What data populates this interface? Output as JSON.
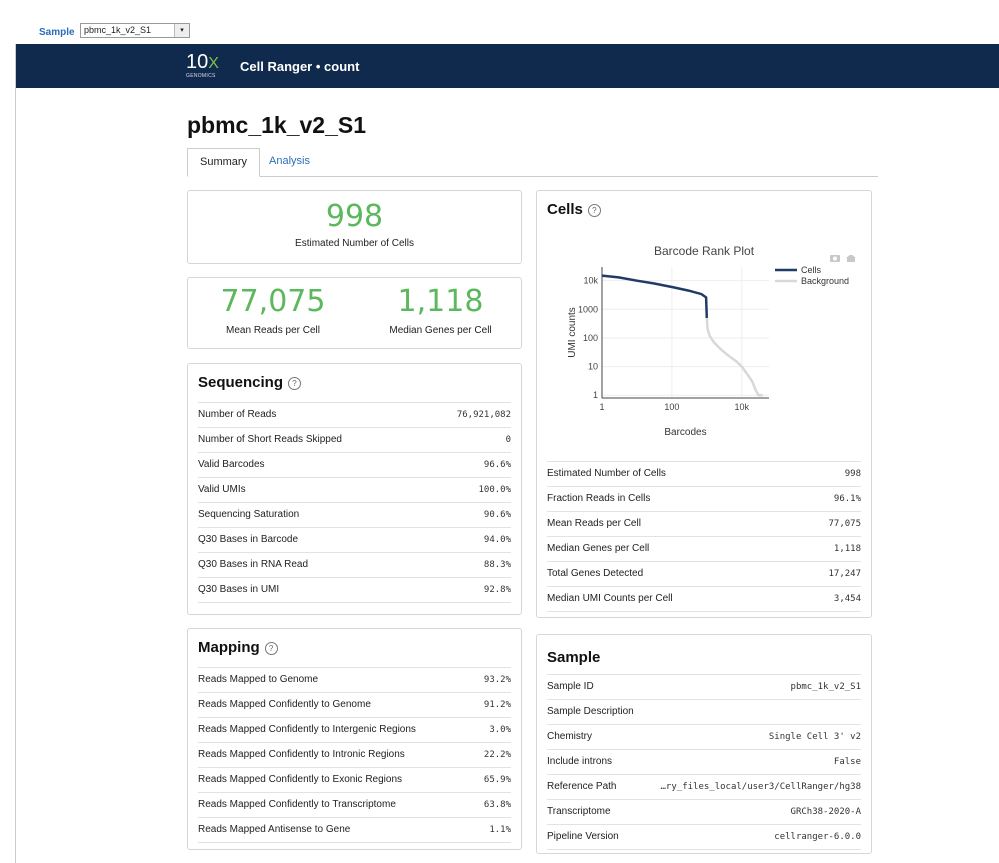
{
  "sample_selector": {
    "label": "Sample",
    "value": "pbmc_1k_v2_S1",
    "arrow": "▾"
  },
  "navbar": {
    "logo_main": "10",
    "logo_x": "X",
    "logo_sub": "GENOMICS",
    "title": "Cell Ranger • count"
  },
  "page": {
    "title": "pbmc_1k_v2_S1"
  },
  "tabs": [
    {
      "label": "Summary"
    },
    {
      "label": "Analysis"
    }
  ],
  "hero": {
    "cells": {
      "value": "998",
      "label": "Estimated Number of Cells"
    },
    "mean_reads": {
      "value": "77,075",
      "label": "Mean Reads per Cell"
    },
    "median_genes": {
      "value": "1,118",
      "label": "Median Genes per Cell"
    }
  },
  "sequencing": {
    "title": "Sequencing",
    "rows": [
      {
        "k": "Number of Reads",
        "v": "76,921,082"
      },
      {
        "k": "Number of Short Reads Skipped",
        "v": "0"
      },
      {
        "k": "Valid Barcodes",
        "v": "96.6%"
      },
      {
        "k": "Valid UMIs",
        "v": "100.0%"
      },
      {
        "k": "Sequencing Saturation",
        "v": "90.6%"
      },
      {
        "k": "Q30 Bases in Barcode",
        "v": "94.0%"
      },
      {
        "k": "Q30 Bases in RNA Read",
        "v": "88.3%"
      },
      {
        "k": "Q30 Bases in UMI",
        "v": "92.8%"
      }
    ]
  },
  "mapping": {
    "title": "Mapping",
    "rows": [
      {
        "k": "Reads Mapped to Genome",
        "v": "93.2%"
      },
      {
        "k": "Reads Mapped Confidently to Genome",
        "v": "91.2%"
      },
      {
        "k": "Reads Mapped Confidently to Intergenic Regions",
        "v": "3.0%"
      },
      {
        "k": "Reads Mapped Confidently to Intronic Regions",
        "v": "22.2%"
      },
      {
        "k": "Reads Mapped Confidently to Exonic Regions",
        "v": "65.9%"
      },
      {
        "k": "Reads Mapped Confidently to Transcriptome",
        "v": "63.8%"
      },
      {
        "k": "Reads Mapped Antisense to Gene",
        "v": "1.1%"
      }
    ]
  },
  "cells": {
    "title": "Cells",
    "rows": [
      {
        "k": "Estimated Number of Cells",
        "v": "998"
      },
      {
        "k": "Fraction Reads in Cells",
        "v": "96.1%"
      },
      {
        "k": "Mean Reads per Cell",
        "v": "77,075"
      },
      {
        "k": "Median Genes per Cell",
        "v": "1,118"
      },
      {
        "k": "Total Genes Detected",
        "v": "17,247"
      },
      {
        "k": "Median UMI Counts per Cell",
        "v": "3,454"
      }
    ]
  },
  "sample": {
    "title": "Sample",
    "rows": [
      {
        "k": "Sample ID",
        "v": "pbmc_1k_v2_S1"
      },
      {
        "k": "Sample Description",
        "v": ""
      },
      {
        "k": "Chemistry",
        "v": "Single Cell 3' v2"
      },
      {
        "k": "Include introns",
        "v": "False"
      },
      {
        "k": "Reference Path",
        "v": "…ry_files_local/user3/CellRanger/hg38"
      },
      {
        "k": "Transcriptome",
        "v": "GRCh38-2020-A"
      },
      {
        "k": "Pipeline Version",
        "v": "cellranger-6.0.0"
      }
    ]
  },
  "chart_data": {
    "type": "line",
    "title": "Barcode Rank Plot",
    "xlabel": "Barcodes",
    "ylabel": "UMI counts",
    "xscale": "log",
    "yscale": "log",
    "xlim": [
      1,
      60000
    ],
    "ylim": [
      0.8,
      30000
    ],
    "xticks": [
      {
        "v": 1,
        "label": "1"
      },
      {
        "v": 100,
        "label": "100"
      },
      {
        "v": 10000,
        "label": "10k"
      }
    ],
    "yticks": [
      {
        "v": 1,
        "label": "1"
      },
      {
        "v": 10,
        "label": "10"
      },
      {
        "v": 100,
        "label": "100"
      },
      {
        "v": 1000,
        "label": "1000"
      },
      {
        "v": 10000,
        "label": "10k"
      }
    ],
    "legend": "top-right",
    "series": [
      {
        "name": "Cells",
        "color": "#1f3b66",
        "points": [
          [
            1,
            15000
          ],
          [
            3,
            13000
          ],
          [
            10,
            10000
          ],
          [
            30,
            8000
          ],
          [
            100,
            6000
          ],
          [
            300,
            4500
          ],
          [
            700,
            3400
          ],
          [
            950,
            2600
          ],
          [
            998,
            500
          ]
        ]
      },
      {
        "name": "Background",
        "color": "#d8d8d8",
        "points": [
          [
            998,
            500
          ],
          [
            1050,
            200
          ],
          [
            1200,
            120
          ],
          [
            1600,
            70
          ],
          [
            2500,
            40
          ],
          [
            4000,
            25
          ],
          [
            7000,
            15
          ],
          [
            10000,
            10
          ],
          [
            15000,
            5
          ],
          [
            20000,
            3
          ],
          [
            25000,
            1.5
          ],
          [
            30000,
            1
          ],
          [
            40000,
            1
          ]
        ]
      }
    ],
    "toolbar_icons": [
      "camera-icon",
      "home-icon"
    ]
  }
}
